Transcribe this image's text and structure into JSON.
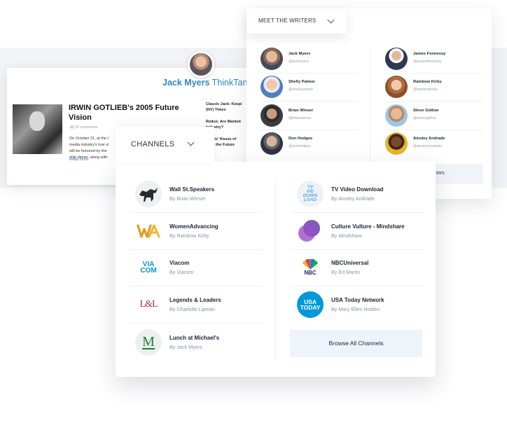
{
  "thinktank": {
    "brand_name": "Jack Myers",
    "brand_suffix": "ThinkTank",
    "article_title": "IRWIN GOTLIEB's 2005 Future Vision",
    "comments": "20 comments",
    "excerpt": "On October 21, at the I\nmedia industry's true vi\nwill be honored by the\nship dinner, along with",
    "read_more": "Read more",
    "side_links": [
      "Classic Jack: Keepi\n(NY) Times",
      "Redux: Are Marketi\nIndustry?",
      "Netflix' House of\nwing the Future"
    ]
  },
  "writers": {
    "tab_label": "MEET THE WRITERS",
    "browse_label": "ters",
    "left": [
      {
        "name": "Jack Myers",
        "handle": "@jackmyers"
      },
      {
        "name": "Shelly Palmer",
        "handle": "@shellypalmer"
      },
      {
        "name": "Brian Wieser",
        "handle": "@brianwieser"
      },
      {
        "name": "Don Hodges",
        "handle": "@donhodges"
      }
    ],
    "right": [
      {
        "name": "James Fennessy",
        "handle": "@jamesfennessy"
      },
      {
        "name": "Rainbow Kirby",
        "handle": "@rainbowkirby"
      },
      {
        "name": "Steve Gidlow",
        "handle": "@stevegidlow"
      },
      {
        "name": "Ainsley Andrade",
        "handle": "@ainsleyandrade"
      }
    ]
  },
  "channels": {
    "tab_label": "CHANNELS",
    "browse_label": "Browse All Channels",
    "left": [
      {
        "name": "Wall St.Speakers",
        "by": "By Brian Wieser",
        "icon": "bull-icon"
      },
      {
        "name": "WomenAdvancing",
        "by": "By Rainbow Kirby",
        "icon": "wa-logo-icon"
      },
      {
        "name": "Viacom",
        "by": "By Viacom",
        "icon": "viacom-logo-icon"
      },
      {
        "name": "Legends & Leaders",
        "by": "By Charlotte Lipman",
        "icon": "ll-logo-icon"
      },
      {
        "name": "Lunch at Michael's",
        "by": "By Jack Myers",
        "icon": "m-logo-icon"
      }
    ],
    "right": [
      {
        "name": "TV Video Download",
        "by": "By Ainsley Andrade",
        "icon": "tvvd-logo-icon"
      },
      {
        "name": "Culture Vulture - Mindshare",
        "by": "By Mindshare",
        "icon": "mindshare-logo-icon"
      },
      {
        "name": "NBCUniversal",
        "by": "By Ed Martin",
        "icon": "nbc-peacock-icon"
      },
      {
        "name": "USA Today Network",
        "by": "By Mary Ellen Holden",
        "icon": "usa-today-logo-icon"
      }
    ]
  },
  "logo_text": {
    "viacom": "VIA\nCOM",
    "ll": "L&L",
    "m": "M",
    "tvvd": "TV\nVID\nDOWN\nLOAD",
    "nbc": "NBC",
    "usa": "USA\nTODAY"
  },
  "colors": {
    "accent_blue": "#2e86c7",
    "viacom_blue": "#0098d8",
    "usa_today_blue": "#0098db",
    "mindshare_purple": "#6a3fb3",
    "ll_red": "#b3283a",
    "m_green": "#1f7a3d"
  }
}
